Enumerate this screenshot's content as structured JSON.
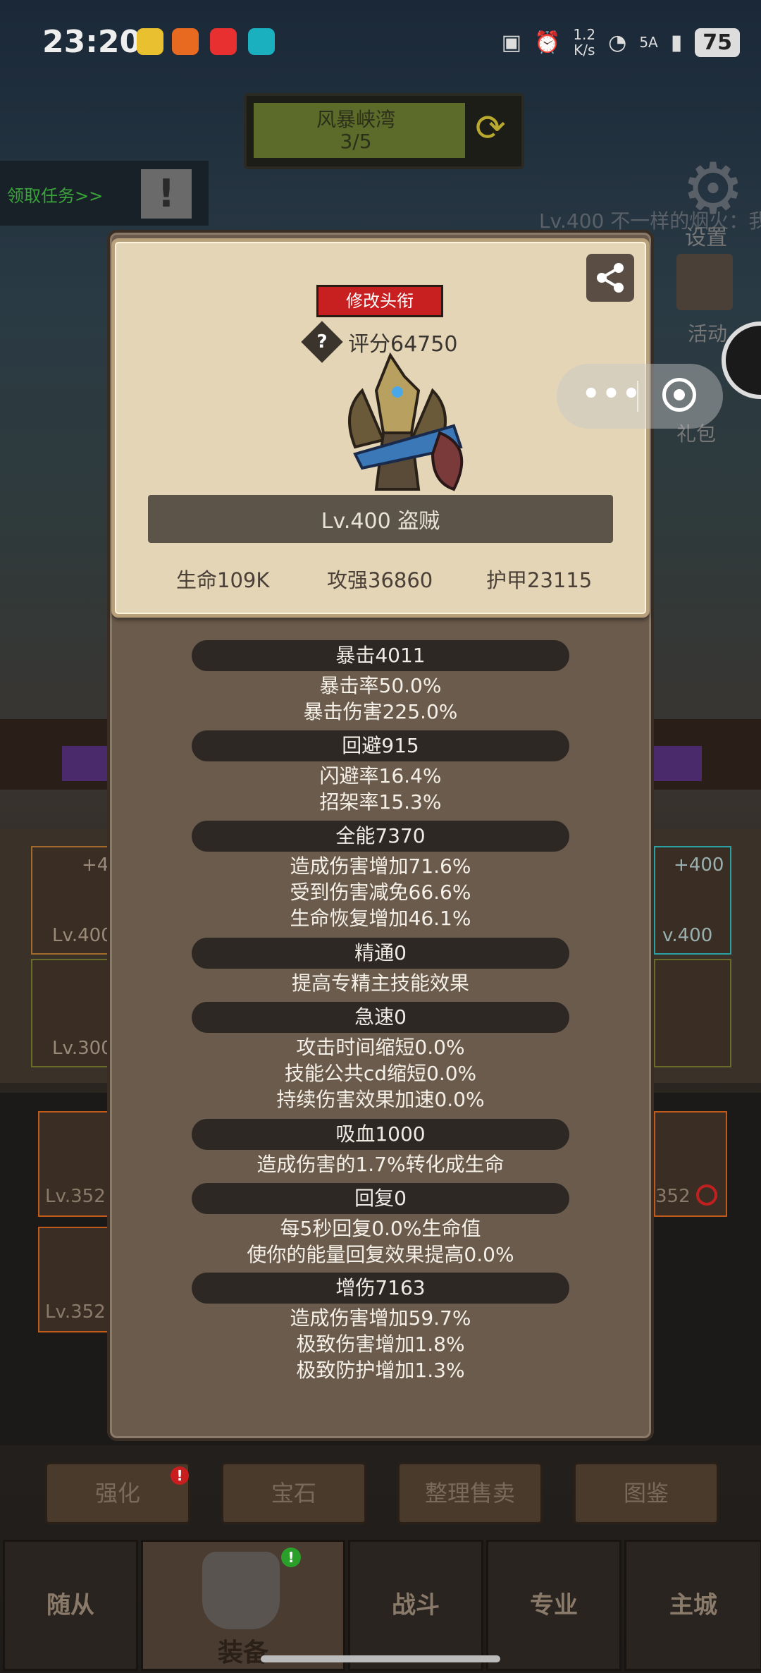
{
  "status_bar": {
    "time": "23:20",
    "network_speed_value": "1.2",
    "network_speed_unit": "K/s",
    "signal": "6",
    "cellular": "5A",
    "battery": "75"
  },
  "map": {
    "name": "风暴峡湾",
    "progress": "3/5"
  },
  "quest": {
    "label": "领取任务>>"
  },
  "side_menu": {
    "settings": "设置",
    "activity": "活动",
    "gift": "礼包"
  },
  "ticker": "Lv.400 不一样的烟火：我",
  "card": {
    "modify_title": "修改头衔",
    "score": "评分64750",
    "hero_level": "Lv.400 盗贼",
    "life": "生命109K",
    "attack": "攻强36860",
    "armor": "护甲23115"
  },
  "stats": [
    {
      "head": "暴击4011",
      "lines": [
        "暴击率50.0%",
        "暴击伤害225.0%"
      ]
    },
    {
      "head": "回避915",
      "lines": [
        "闪避率16.4%",
        "招架率15.3%"
      ]
    },
    {
      "head": "全能7370",
      "lines": [
        "造成伤害增加71.6%",
        "受到伤害减免66.6%",
        "生命恢复增加46.1%"
      ]
    },
    {
      "head": "精通0",
      "lines": [
        "提高专精主技能效果"
      ]
    },
    {
      "head": "急速0",
      "lines": [
        "攻击时间缩短0.0%",
        "技能公共cd缩短0.0%",
        "持续伤害效果加速0.0%"
      ]
    },
    {
      "head": "吸血1000",
      "lines": [
        "造成伤害的1.7%转化成生命"
      ]
    },
    {
      "head": "回复0",
      "lines": [
        "每5秒回复0.0%生命值",
        "使你的能量回复效果提高0.0%"
      ]
    },
    {
      "head": "增伤7163",
      "lines": [
        "造成伤害增加59.7%",
        "极致伤害增加1.8%",
        "极致防护增加1.3%"
      ]
    }
  ],
  "equipment_slots": {
    "left_top_plus": "+4",
    "left_top_level": "Lv.400",
    "left_mid_level": "Lv.300",
    "right_top_plus": "+400",
    "right_top_level": "v.400",
    "bag_left_1": "Lv.352",
    "bag_left_2": "Lv.352",
    "bag_right_1": "352"
  },
  "bottom_buttons": {
    "enhance": "强化",
    "gem": "宝石",
    "sort_sell": "整理售卖",
    "atlas": "图鉴"
  },
  "nav": {
    "follower": "随从",
    "equip": "装备",
    "battle": "战斗",
    "profession": "专业",
    "main_city": "主城"
  },
  "colors": {
    "panel": "#6b5b4c",
    "card": "#e4d5b6",
    "stat_pill": "#2e2824",
    "modify_btn": "#c82020"
  }
}
